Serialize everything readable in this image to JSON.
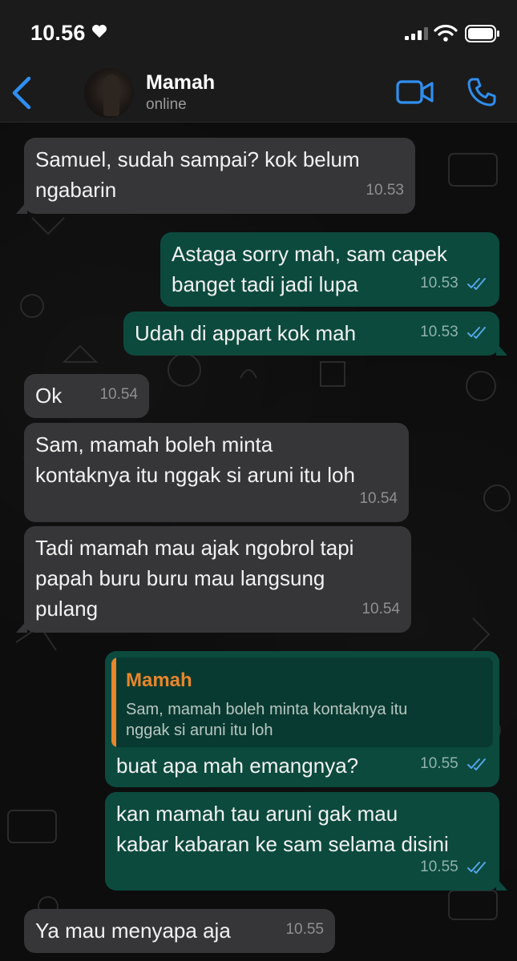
{
  "status_bar": {
    "time": "10.56"
  },
  "header": {
    "contact_name": "Mamah",
    "contact_status": "online"
  },
  "messages": [
    {
      "direction": "in",
      "text": "Samuel, sudah sampai? kok belum\nngabarin",
      "time": "10.53"
    },
    {
      "direction": "out",
      "text": "Astaga sorry mah, sam capek\nbanget tadi jadi lupa",
      "time": "10.53",
      "read": true
    },
    {
      "direction": "out",
      "text": "Udah di appart kok mah",
      "time": "10.53",
      "read": true
    },
    {
      "direction": "in",
      "text": "Ok",
      "time": "10.54"
    },
    {
      "direction": "in",
      "text": "Sam, mamah boleh minta\nkontaknya itu nggak si aruni itu loh",
      "time": "10.54"
    },
    {
      "direction": "in",
      "text": "Tadi mamah mau ajak ngobrol tapi\npapah buru buru mau langsung\npulang",
      "time": "10.54"
    },
    {
      "direction": "out",
      "quote": {
        "author": "Mamah",
        "text": "Sam, mamah boleh minta kontaknya itu\nnggak si aruni itu loh"
      },
      "text": "buat apa mah emangnya?",
      "time": "10.55",
      "read": true
    },
    {
      "direction": "out",
      "text": "kan mamah tau aruni gak mau\nkabar kabaran ke sam selama disini",
      "time": "10.55",
      "read": true
    },
    {
      "direction": "in",
      "text": "Ya mau menyapa aja",
      "time": "10.55"
    }
  ],
  "colors": {
    "accent": "#2f8ff0",
    "incoming_bubble": "#363638",
    "outgoing_bubble": "#0c4a3e",
    "quote_author": "#e8862a",
    "read_ticks": "#53a6e8"
  }
}
